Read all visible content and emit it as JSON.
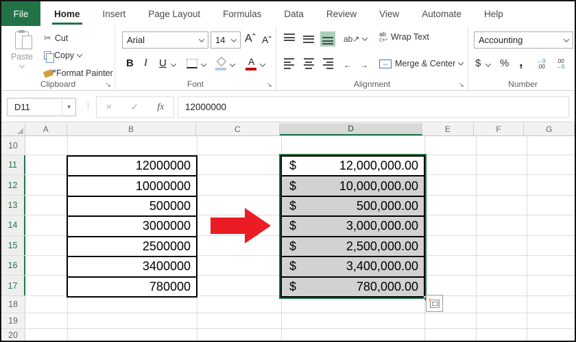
{
  "ribbon_tabs": {
    "file": "File",
    "active": "Home",
    "tabs": [
      "Home",
      "Insert",
      "Page Layout",
      "Formulas",
      "Data",
      "Review",
      "View",
      "Automate",
      "Help"
    ]
  },
  "groups": {
    "clipboard": {
      "title": "Clipboard",
      "paste": "Paste",
      "cut": "Cut",
      "copy": "Copy",
      "format_painter": "Format Painter"
    },
    "font": {
      "title": "Font",
      "name": "Arial",
      "size": "14",
      "bold": "B",
      "italic": "I",
      "underline": "U",
      "grow": "Aˆ",
      "shrink": "Aˇ",
      "font_color_letter": "A"
    },
    "alignment": {
      "title": "Alignment",
      "wrap": "Wrap Text",
      "merge": "Merge & Center"
    },
    "number": {
      "title": "Number",
      "format": "Accounting",
      "currency": "$",
      "percent": "%",
      "comma": ","
    }
  },
  "icons": {
    "scissors": "✂",
    "close": "×",
    "check": "✓",
    "fx": "fx",
    "dropdown": "▾",
    "launcher": "↘",
    "dots": "⋮",
    "wrap_top": "ab",
    "wrap_bottom": "c↩",
    "merge_arrows": "↔",
    "orientation": "ab↗",
    "indent_left": "←",
    "indent_right": "→",
    "inc_dec_top": "←0",
    "inc_dec_bottom": ".00",
    "dec_dec_top": ".00",
    "dec_dec_bottom": "→0"
  },
  "formula_bar": {
    "name_box": "D11",
    "value": "12000000"
  },
  "sheet": {
    "col_headers": [
      "A",
      "B",
      "C",
      "D",
      "E",
      "F",
      "G"
    ],
    "selected_col": "D",
    "row_headers": [
      "10",
      "11",
      "12",
      "13",
      "14",
      "15",
      "16",
      "17",
      "18",
      "19",
      "20"
    ],
    "b_cells": [
      "12000000",
      "10000000",
      "500000",
      "3000000",
      "2500000",
      "3400000",
      "780000"
    ],
    "d_cells": [
      {
        "sym": "$",
        "amt": "12,000,000.00"
      },
      {
        "sym": "$",
        "amt": "10,000,000.00"
      },
      {
        "sym": "$",
        "amt": "500,000.00"
      },
      {
        "sym": "$",
        "amt": "3,000,000.00"
      },
      {
        "sym": "$",
        "amt": "2,500,000.00"
      },
      {
        "sym": "$",
        "amt": "3,400,000.00"
      },
      {
        "sym": "$",
        "amt": "780,000.00"
      }
    ]
  },
  "colors": {
    "excel_green": "#217346",
    "selection_gray": "#d2d2d2",
    "arrow_red": "#ec1c24"
  }
}
